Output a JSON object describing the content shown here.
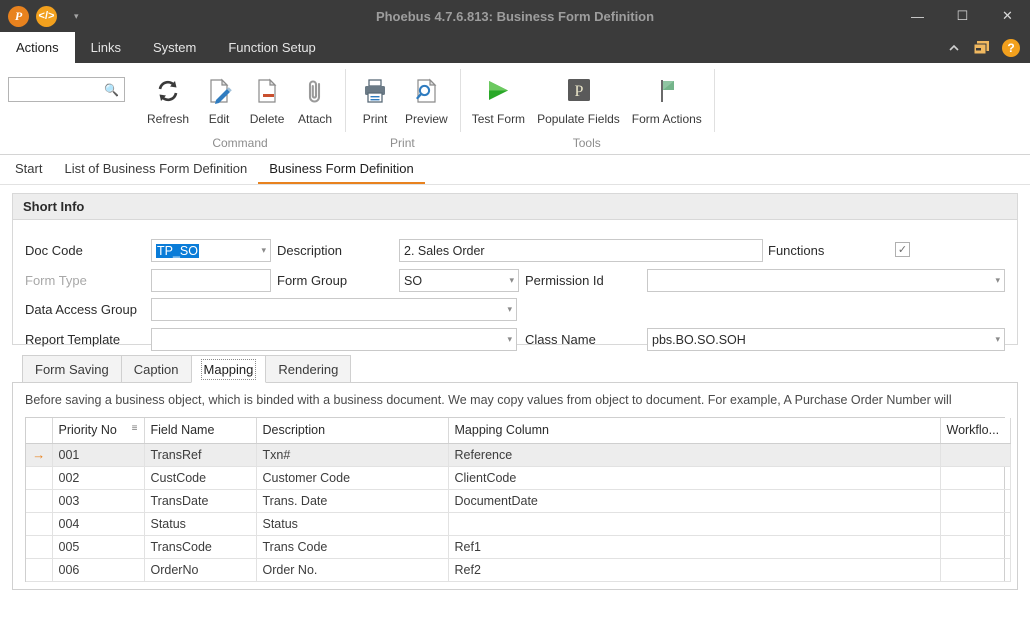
{
  "window": {
    "title": "Phoebus 4.7.6.813: Business Form Definition",
    "logo_p": "P",
    "logo_code": "</>",
    "qat_arrow": "▾",
    "minimize": "—",
    "maximize": "☐",
    "close": "✕"
  },
  "menubar": {
    "items": [
      {
        "label": "Actions",
        "active": true
      },
      {
        "label": "Links",
        "active": false
      },
      {
        "label": "System",
        "active": false
      },
      {
        "label": "Function Setup",
        "active": false
      }
    ],
    "collapse_icon": "collapse-ribbon-icon",
    "window_icon": "windows-icon",
    "help_label": "?"
  },
  "ribbon": {
    "search": {
      "value": "",
      "placeholder": ""
    },
    "groups": [
      {
        "title": "Command",
        "buttons": [
          {
            "label": "Refresh",
            "icon": "refresh-icon"
          },
          {
            "label": "Edit",
            "icon": "edit-icon"
          },
          {
            "label": "Delete",
            "icon": "delete-icon"
          },
          {
            "label": "Attach",
            "icon": "attach-icon"
          }
        ]
      },
      {
        "title": "Print",
        "buttons": [
          {
            "label": "Print",
            "icon": "print-icon"
          },
          {
            "label": "Preview",
            "icon": "preview-icon"
          }
        ]
      },
      {
        "title": "Tools",
        "buttons": [
          {
            "label": "Test Form",
            "icon": "play-icon"
          },
          {
            "label": "Populate Fields",
            "icon": "populate-icon"
          },
          {
            "label": "Form Actions",
            "icon": "flag-icon"
          }
        ]
      }
    ]
  },
  "doctabs": [
    {
      "label": "Start",
      "active": false
    },
    {
      "label": "List of Business Form Definition",
      "active": false
    },
    {
      "label": "Business Form Definition",
      "active": true
    }
  ],
  "short_info": {
    "title": "Short Info",
    "doc_code_label": "Doc Code",
    "doc_code_value": "TP_SO",
    "description_label": "Description",
    "description_value": "2. Sales Order",
    "functions_label": "Functions",
    "functions_checked": "✓",
    "form_type_label": "Form Type",
    "form_type_value": "",
    "form_group_label": "Form Group",
    "form_group_value": "SO",
    "permission_id_label": "Permission Id",
    "permission_id_value": "",
    "data_access_group_label": "Data Access Group",
    "data_access_group_value": "",
    "report_template_label": "Report Template",
    "report_template_value": "",
    "class_name_label": "Class Name",
    "class_name_value": "pbs.BO.SO.SOH",
    "caret": "▾"
  },
  "lower_tabs": [
    {
      "label": "Form Saving",
      "active": false
    },
    {
      "label": "Caption",
      "active": false
    },
    {
      "label": "Mapping",
      "active": true
    },
    {
      "label": "Rendering",
      "active": false
    }
  ],
  "mapping": {
    "help_text": "Before saving a business object, which is binded with a business document. We may copy values from object to  document. For example, A Purchase Order Number will",
    "columns": [
      "Priority No",
      "Field Name",
      "Description",
      "Mapping Column",
      "Workflo..."
    ],
    "sort_icon": "sort-ascending-icon",
    "selected_marker": "→",
    "rows": [
      {
        "priority": "001",
        "field": "TransRef",
        "description": "Txn#",
        "mapping": "Reference",
        "workflow": "",
        "selected": true
      },
      {
        "priority": "002",
        "field": "CustCode",
        "description": "Customer Code",
        "mapping": "ClientCode",
        "workflow": "",
        "selected": false
      },
      {
        "priority": "003",
        "field": "TransDate",
        "description": "Trans. Date",
        "mapping": "DocumentDate",
        "workflow": "",
        "selected": false
      },
      {
        "priority": "004",
        "field": "Status",
        "description": "Status",
        "mapping": "",
        "workflow": "",
        "selected": false
      },
      {
        "priority": "005",
        "field": "TransCode",
        "description": "Trans Code",
        "mapping": "Ref1",
        "workflow": "",
        "selected": false
      },
      {
        "priority": "006",
        "field": "OrderNo",
        "description": "Order No.",
        "mapping": "Ref2",
        "workflow": "",
        "selected": false
      }
    ]
  },
  "colors": {
    "accent_orange": "#e8821e",
    "selection_blue": "#0a7cd8",
    "titlebar": "#3b3b3b"
  }
}
